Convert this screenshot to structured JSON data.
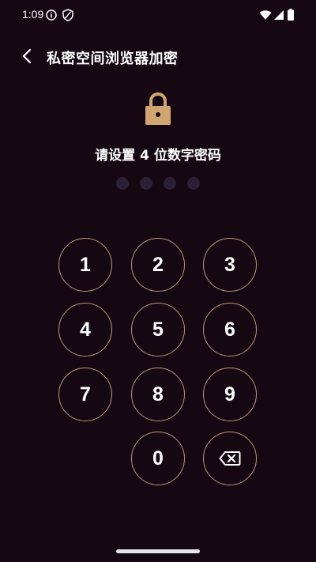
{
  "status_bar": {
    "time": "1:09",
    "icons": [
      "info-icon",
      "shield-icon",
      "wifi-icon",
      "signal-icon",
      "battery-icon"
    ]
  },
  "header": {
    "title": "私密空间浏览器加密",
    "back_icon": "back-arrow-icon"
  },
  "lock": {
    "icon": "lock-icon",
    "color": "#d1a56f"
  },
  "prompt": "请设置 4 位数字密码",
  "pin": {
    "length": 4,
    "entered": 0
  },
  "keypad": {
    "keys": [
      "1",
      "2",
      "3",
      "4",
      "5",
      "6",
      "7",
      "8",
      "9",
      "0"
    ],
    "delete_icon": "backspace-icon",
    "ring_color": "#b79a78"
  },
  "colors": {
    "background": "#150813",
    "dot_empty": "#2b2036",
    "accent": "#d1a56f"
  }
}
